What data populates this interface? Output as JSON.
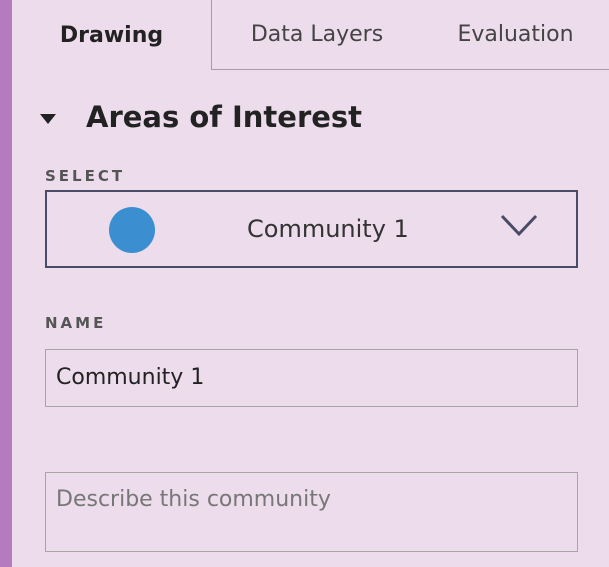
{
  "tabs": {
    "drawing": "Drawing",
    "data_layers": "Data Layers",
    "evaluation": "Evaluation"
  },
  "section": {
    "title": "Areas of Interest",
    "expanded": true
  },
  "select": {
    "label": "SELECT",
    "value": "Community 1",
    "color": "#3b8fd1"
  },
  "name": {
    "label": "NAME",
    "value": "Community 1"
  },
  "description": {
    "placeholder": "Describe this community"
  },
  "icons": {
    "section_toggle": "caret-down-icon",
    "select_open": "chevron-down-icon"
  },
  "colors": {
    "sidebar": "#b57bbf",
    "panel": "#ecdcec",
    "select_border": "#4a4b66"
  }
}
